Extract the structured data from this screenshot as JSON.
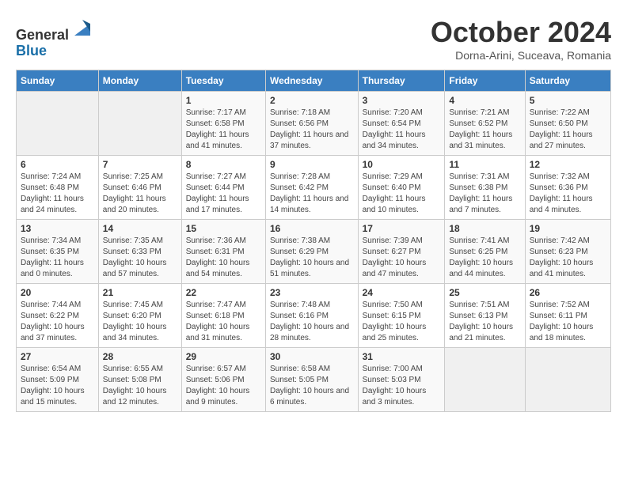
{
  "header": {
    "logo_line1": "General",
    "logo_line2": "Blue",
    "month": "October 2024",
    "location": "Dorna-Arini, Suceava, Romania"
  },
  "days_of_week": [
    "Sunday",
    "Monday",
    "Tuesday",
    "Wednesday",
    "Thursday",
    "Friday",
    "Saturday"
  ],
  "weeks": [
    [
      {
        "day": "",
        "info": ""
      },
      {
        "day": "",
        "info": ""
      },
      {
        "day": "1",
        "info": "Sunrise: 7:17 AM\nSunset: 6:58 PM\nDaylight: 11 hours and 41 minutes."
      },
      {
        "day": "2",
        "info": "Sunrise: 7:18 AM\nSunset: 6:56 PM\nDaylight: 11 hours and 37 minutes."
      },
      {
        "day": "3",
        "info": "Sunrise: 7:20 AM\nSunset: 6:54 PM\nDaylight: 11 hours and 34 minutes."
      },
      {
        "day": "4",
        "info": "Sunrise: 7:21 AM\nSunset: 6:52 PM\nDaylight: 11 hours and 31 minutes."
      },
      {
        "day": "5",
        "info": "Sunrise: 7:22 AM\nSunset: 6:50 PM\nDaylight: 11 hours and 27 minutes."
      }
    ],
    [
      {
        "day": "6",
        "info": "Sunrise: 7:24 AM\nSunset: 6:48 PM\nDaylight: 11 hours and 24 minutes."
      },
      {
        "day": "7",
        "info": "Sunrise: 7:25 AM\nSunset: 6:46 PM\nDaylight: 11 hours and 20 minutes."
      },
      {
        "day": "8",
        "info": "Sunrise: 7:27 AM\nSunset: 6:44 PM\nDaylight: 11 hours and 17 minutes."
      },
      {
        "day": "9",
        "info": "Sunrise: 7:28 AM\nSunset: 6:42 PM\nDaylight: 11 hours and 14 minutes."
      },
      {
        "day": "10",
        "info": "Sunrise: 7:29 AM\nSunset: 6:40 PM\nDaylight: 11 hours and 10 minutes."
      },
      {
        "day": "11",
        "info": "Sunrise: 7:31 AM\nSunset: 6:38 PM\nDaylight: 11 hours and 7 minutes."
      },
      {
        "day": "12",
        "info": "Sunrise: 7:32 AM\nSunset: 6:36 PM\nDaylight: 11 hours and 4 minutes."
      }
    ],
    [
      {
        "day": "13",
        "info": "Sunrise: 7:34 AM\nSunset: 6:35 PM\nDaylight: 11 hours and 0 minutes."
      },
      {
        "day": "14",
        "info": "Sunrise: 7:35 AM\nSunset: 6:33 PM\nDaylight: 10 hours and 57 minutes."
      },
      {
        "day": "15",
        "info": "Sunrise: 7:36 AM\nSunset: 6:31 PM\nDaylight: 10 hours and 54 minutes."
      },
      {
        "day": "16",
        "info": "Sunrise: 7:38 AM\nSunset: 6:29 PM\nDaylight: 10 hours and 51 minutes."
      },
      {
        "day": "17",
        "info": "Sunrise: 7:39 AM\nSunset: 6:27 PM\nDaylight: 10 hours and 47 minutes."
      },
      {
        "day": "18",
        "info": "Sunrise: 7:41 AM\nSunset: 6:25 PM\nDaylight: 10 hours and 44 minutes."
      },
      {
        "day": "19",
        "info": "Sunrise: 7:42 AM\nSunset: 6:23 PM\nDaylight: 10 hours and 41 minutes."
      }
    ],
    [
      {
        "day": "20",
        "info": "Sunrise: 7:44 AM\nSunset: 6:22 PM\nDaylight: 10 hours and 37 minutes."
      },
      {
        "day": "21",
        "info": "Sunrise: 7:45 AM\nSunset: 6:20 PM\nDaylight: 10 hours and 34 minutes."
      },
      {
        "day": "22",
        "info": "Sunrise: 7:47 AM\nSunset: 6:18 PM\nDaylight: 10 hours and 31 minutes."
      },
      {
        "day": "23",
        "info": "Sunrise: 7:48 AM\nSunset: 6:16 PM\nDaylight: 10 hours and 28 minutes."
      },
      {
        "day": "24",
        "info": "Sunrise: 7:50 AM\nSunset: 6:15 PM\nDaylight: 10 hours and 25 minutes."
      },
      {
        "day": "25",
        "info": "Sunrise: 7:51 AM\nSunset: 6:13 PM\nDaylight: 10 hours and 21 minutes."
      },
      {
        "day": "26",
        "info": "Sunrise: 7:52 AM\nSunset: 6:11 PM\nDaylight: 10 hours and 18 minutes."
      }
    ],
    [
      {
        "day": "27",
        "info": "Sunrise: 6:54 AM\nSunset: 5:09 PM\nDaylight: 10 hours and 15 minutes."
      },
      {
        "day": "28",
        "info": "Sunrise: 6:55 AM\nSunset: 5:08 PM\nDaylight: 10 hours and 12 minutes."
      },
      {
        "day": "29",
        "info": "Sunrise: 6:57 AM\nSunset: 5:06 PM\nDaylight: 10 hours and 9 minutes."
      },
      {
        "day": "30",
        "info": "Sunrise: 6:58 AM\nSunset: 5:05 PM\nDaylight: 10 hours and 6 minutes."
      },
      {
        "day": "31",
        "info": "Sunrise: 7:00 AM\nSunset: 5:03 PM\nDaylight: 10 hours and 3 minutes."
      },
      {
        "day": "",
        "info": ""
      },
      {
        "day": "",
        "info": ""
      }
    ]
  ]
}
